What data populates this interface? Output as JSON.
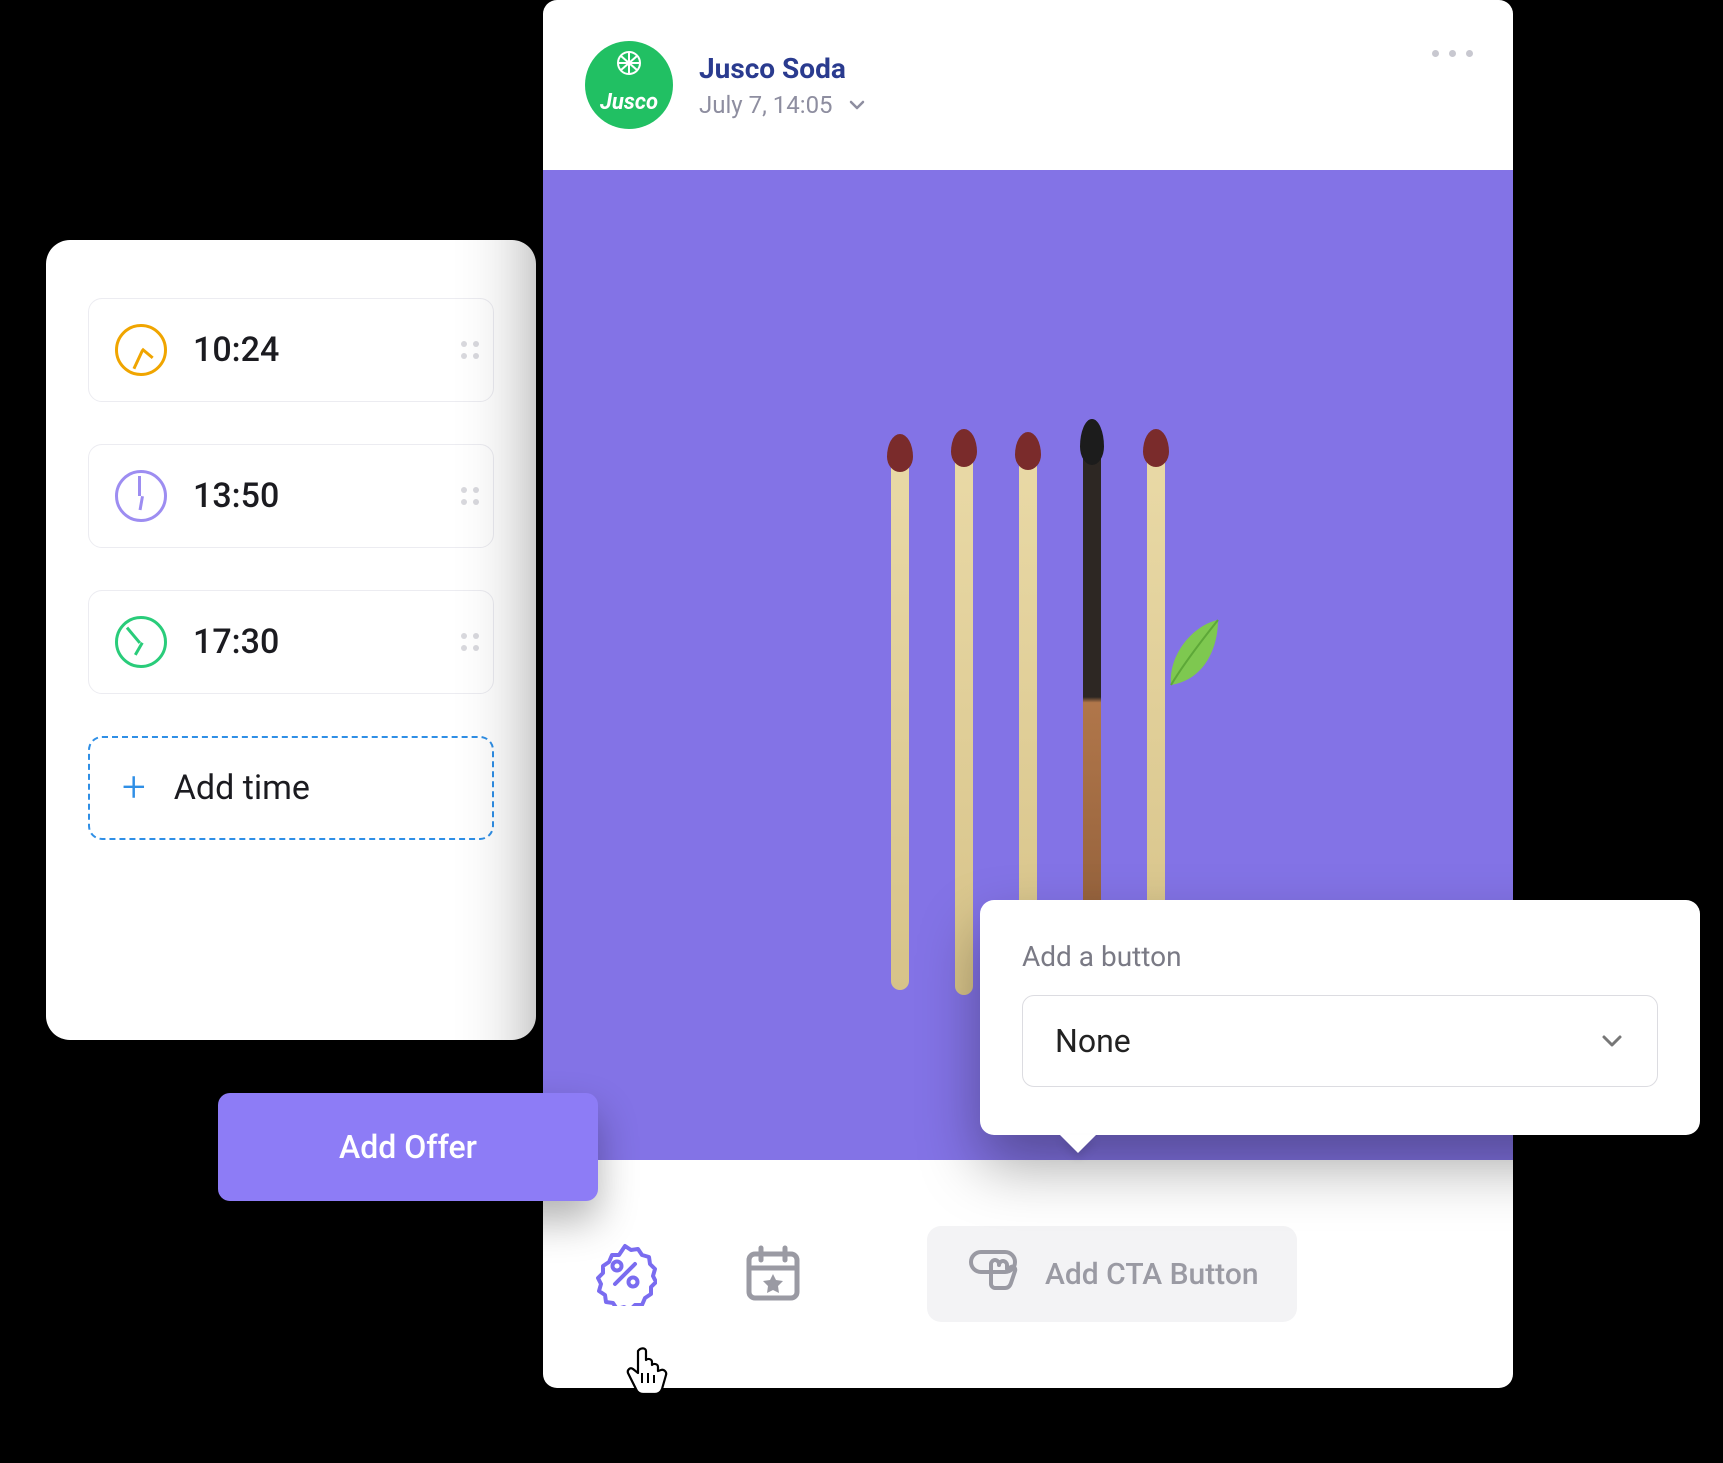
{
  "time_panel": {
    "items": [
      {
        "time": "10:24",
        "color": "#f0a500"
      },
      {
        "time": "13:50",
        "color": "#9d8df1"
      },
      {
        "time": "17:30",
        "color": "#29cc7a"
      }
    ],
    "add_label": "Add time"
  },
  "add_offer_label": "Add Offer",
  "post": {
    "account_name": "Jusco Soda",
    "avatar_text": "Jusco",
    "date": "July 7, 14:05"
  },
  "footer": {
    "cta_chip_label": "Add CTA Button"
  },
  "dropdown": {
    "title": "Add a button",
    "selected": "None"
  }
}
